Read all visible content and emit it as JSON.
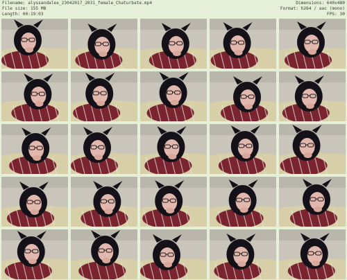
{
  "header": {
    "filename": "Filename: alyssandalex_23042017_2031_female_Chaturbate.mp4",
    "filesize": "File size: 155 MB",
    "length": "Length: 00:19:03",
    "dimensions": "Dimensions: 640x480",
    "format": "Format: h264 / aac (mono)",
    "fps": "FPS: 30"
  },
  "colors": {
    "background": "#e6efd8",
    "header_text": "#3a3a3a",
    "wall": "#c9c5ba",
    "blanket": "#d6cfa8",
    "hair": "#141218",
    "shirt_red": "#7a2430",
    "skin": "#e2b8ae"
  },
  "thumbnails": [
    {
      "caption": ""
    },
    {
      "caption": ""
    },
    {
      "caption": ""
    },
    {
      "caption": ""
    },
    {
      "caption": ""
    },
    {
      "caption": ""
    },
    {
      "caption": ""
    },
    {
      "caption": ""
    },
    {
      "caption": ""
    },
    {
      "caption": ""
    },
    {
      "caption": ""
    },
    {
      "caption": ""
    },
    {
      "caption": ""
    },
    {
      "caption": ""
    },
    {
      "caption": ""
    },
    {
      "caption": ""
    },
    {
      "caption": ""
    },
    {
      "caption": ""
    },
    {
      "caption": ""
    },
    {
      "caption": ""
    },
    {
      "caption": ""
    },
    {
      "caption": ""
    },
    {
      "caption": ""
    },
    {
      "caption": ""
    },
    {
      "caption": ""
    }
  ]
}
